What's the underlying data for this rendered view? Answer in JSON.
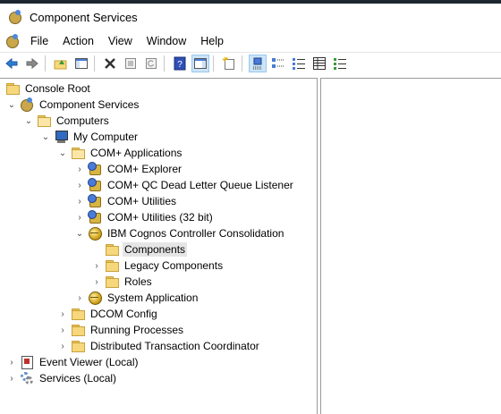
{
  "window": {
    "title": "Component Services"
  },
  "menu": {
    "items": [
      "File",
      "Action",
      "View",
      "Window",
      "Help"
    ]
  },
  "toolbar": {
    "buttons": [
      "back-icon",
      "forward-icon",
      "up-folder-icon",
      "show-hide-tree-icon",
      "delete-icon",
      "properties-icon",
      "refresh-icon",
      "help-icon",
      "action-pane-icon",
      "new-icon",
      "large-icons-icon",
      "small-icons-icon",
      "list-icon",
      "details-icon"
    ]
  },
  "tree": {
    "console_root": "Console Root",
    "component_services": "Component Services",
    "computers": "Computers",
    "my_computer": "My Computer",
    "com_apps": "COM+ Applications",
    "com_explorer": "COM+ Explorer",
    "com_qc": "COM+ QC Dead Letter Queue Listener",
    "com_utilities": "COM+ Utilities",
    "com_utilities32": "COM+ Utilities (32 bit)",
    "ibm": "IBM Cognos Controller Consolidation",
    "components": "Components",
    "legacy": "Legacy Components",
    "roles": "Roles",
    "system_app": "System Application",
    "dcom": "DCOM Config",
    "running": "Running Processes",
    "dtc": "Distributed Transaction Coordinator",
    "event_viewer": "Event Viewer (Local)",
    "services": "Services (Local)"
  }
}
